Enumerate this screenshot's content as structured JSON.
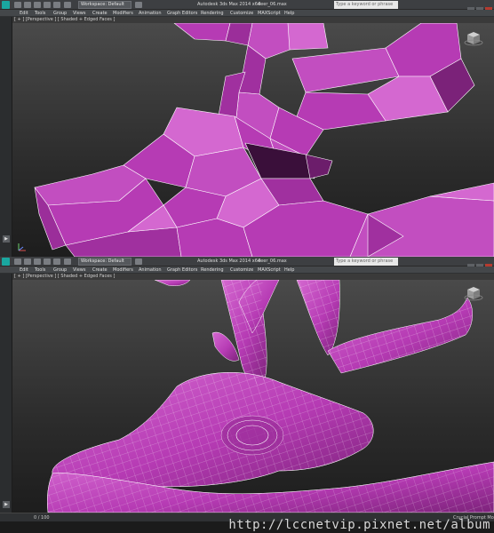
{
  "top_window": {
    "workspace": "Workspace: Default",
    "app_title": "Autodesk 3ds Max 2014 x64",
    "file_name": "deer_06.max",
    "search_placeholder": "Type a keyword or phrase",
    "menu": [
      "Edit",
      "Tools",
      "Group",
      "Views",
      "Create",
      "Modifiers",
      "Animation",
      "Graph Editors",
      "Rendering",
      "Customize",
      "MAXScript",
      "Help"
    ],
    "viewport_label": "[ + ] [Perspective ] [ Shaded + Edged Faces ]"
  },
  "bottom_window": {
    "workspace": "Workspace: Default",
    "app_title": "Autodesk 3ds Max 2014 x64",
    "file_name": "deer_06.max",
    "search_placeholder": "Type a keyword or phrase",
    "menu": [
      "Edit",
      "Tools",
      "Group",
      "Views",
      "Create",
      "Modifiers",
      "Animation",
      "Graph Editors",
      "Rendering",
      "Customize",
      "MAXScript",
      "Help"
    ],
    "viewport_label": "[ + ] [Perspective ] [ Shaded + Edged Faces ]",
    "status_left": "0 / 100",
    "status_right": "Crucial Prompt Mode"
  },
  "watermark": "http://lccnetvip.pixnet.net/album",
  "colors": {
    "mesh": "#b63bb4",
    "mesh_light": "#d468d0",
    "mesh_dark": "#5e1a5d",
    "wire": "#ffffff"
  }
}
